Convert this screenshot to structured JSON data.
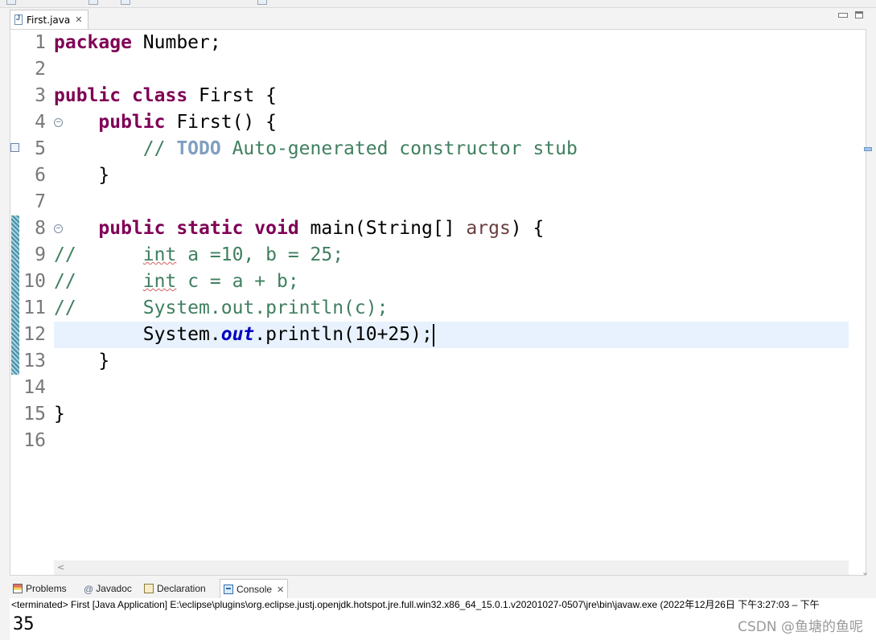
{
  "editor": {
    "tab_label": "First.java",
    "lines": [
      {
        "n": "1"
      },
      {
        "n": "2"
      },
      {
        "n": "3"
      },
      {
        "n": "4"
      },
      {
        "n": "5"
      },
      {
        "n": "6"
      },
      {
        "n": "7"
      },
      {
        "n": "8"
      },
      {
        "n": "9"
      },
      {
        "n": "10"
      },
      {
        "n": "11"
      },
      {
        "n": "12"
      },
      {
        "n": "13"
      },
      {
        "n": "14"
      },
      {
        "n": "15"
      },
      {
        "n": "16"
      }
    ],
    "code": {
      "l1_kw": "package",
      "l1_rest": " Number;",
      "l3_kw1": "public",
      "l3_kw2": "class",
      "l3_rest": " First {",
      "l4_indent": "    ",
      "l4_kw": "public",
      "l4_rest": " First() {",
      "l5_indent": "        ",
      "l5_slashes": "// ",
      "l5_todo": "TODO",
      "l5_rest": " Auto-generated constructor stub",
      "l6": "    }",
      "l8_indent": "    ",
      "l8_kw1": "public",
      "l8_kw2": "static",
      "l8_kw3": "void",
      "l8_mid": " main(String[] ",
      "l8_param": "args",
      "l8_end": ") {",
      "l9_slashes": "//",
      "l9_gap": "      ",
      "l9_int": "int",
      "l9_rest": " a =10, b = 25;",
      "l10_slashes": "//",
      "l10_gap": "      ",
      "l10_int": "int",
      "l10_rest": " c = a + b;",
      "l11_slashes": "//",
      "l11_gap": "      ",
      "l11_rest": "System.out.println(c);",
      "l12_indent": "        ",
      "l12_a": "System.",
      "l12_field": "out",
      "l12_b": ".println(10+25);",
      "l13": "    }",
      "l15": "}"
    }
  },
  "views": {
    "tabs": [
      {
        "label": "Problems",
        "icon": "problems-icon"
      },
      {
        "label": "Javadoc",
        "icon": "at-icon",
        "glyph": "@"
      },
      {
        "label": "Declaration",
        "icon": "declaration-icon"
      },
      {
        "label": "Console",
        "icon": "console-icon",
        "active": true
      }
    ],
    "close_glyph": "✕"
  },
  "console": {
    "status_line": "<terminated> First [Java Application] E:\\eclipse\\plugins\\org.eclipse.justj.openjdk.hotspot.jre.full.win32.x86_64_15.0.1.v20201027-0507\\jre\\bin\\javaw.exe  (2022年12月26日 下午3:27:03 – 下午",
    "output": "35"
  },
  "watermark": "CSDN @鱼塘的鱼呢",
  "colors": {
    "keyword": "#7f0055",
    "comment": "#3f7f5f",
    "todo": "#7f9fbf",
    "field": "#0000c0",
    "current_line": "#e8f2fe"
  }
}
